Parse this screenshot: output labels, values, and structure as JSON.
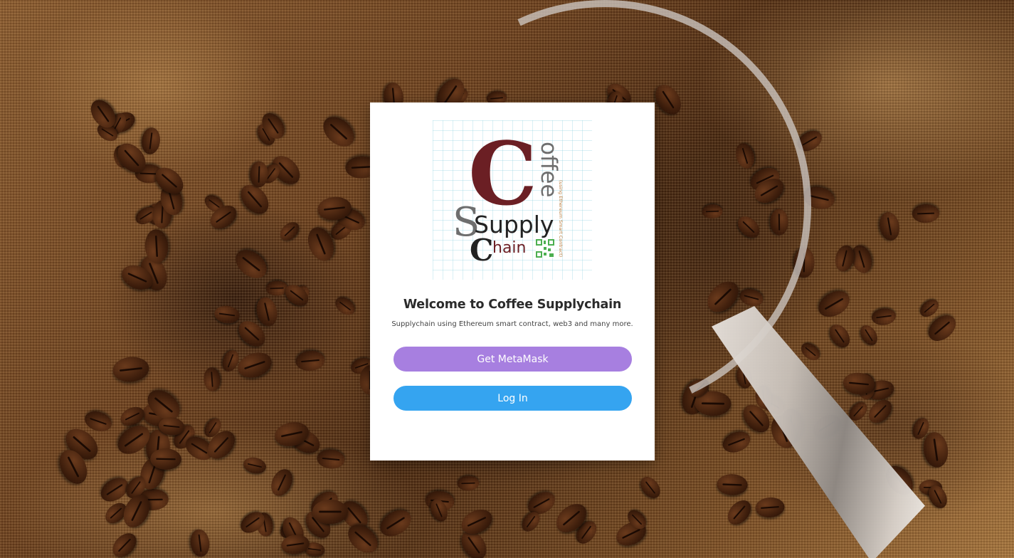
{
  "welcome": {
    "title": "Welcome to Coffee Supplychain",
    "subtitle": "Supplychain using Ethereum smart contract, web3 and many more."
  },
  "logo": {
    "big_letter": "C",
    "word_offee": "offee",
    "word_supply": "Supply",
    "word_chain": "hain",
    "chain_letter": "C",
    "s_letter": "S",
    "vertical_tagline": "(using Ethereum Smart Contract)"
  },
  "buttons": {
    "metamask_label": "Get MetaMask",
    "login_label": "Log In"
  },
  "colors": {
    "logo_maroon": "#6b1f24",
    "logo_gray": "#6e6e6e",
    "logo_green": "#4caf50",
    "metamask_button": "#a77fe0",
    "login_button": "#35a4f0"
  },
  "icons": {
    "qr_code": "qr-code-icon"
  }
}
